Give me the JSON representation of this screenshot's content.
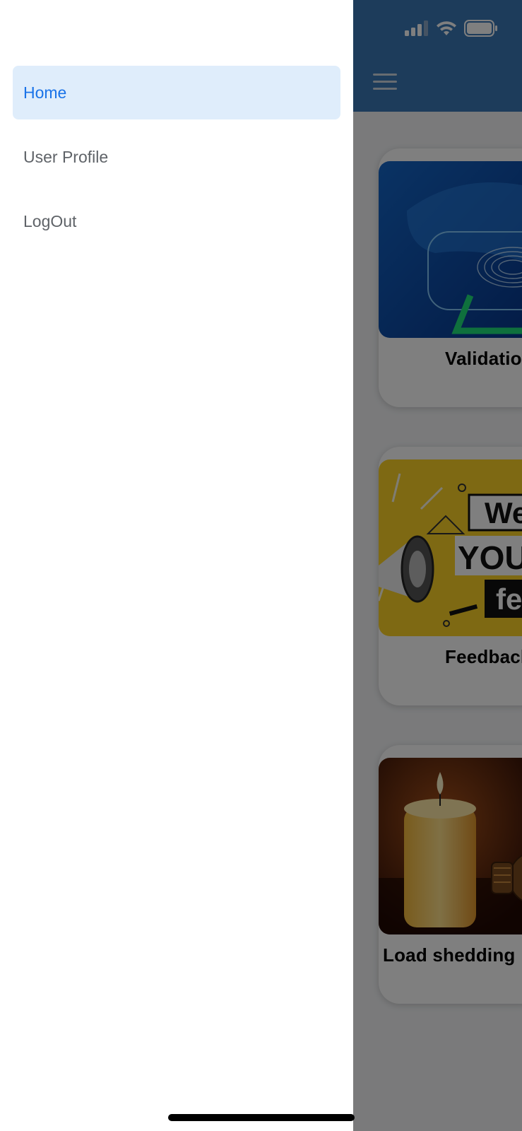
{
  "drawer": {
    "items": [
      {
        "label": "Home",
        "active": true
      },
      {
        "label": "User Profile",
        "active": false
      },
      {
        "label": "LogOut",
        "active": false
      }
    ]
  },
  "app": {
    "header_color": "#3a79b7",
    "menu_icon": "hamburger-menu-icon",
    "cards": [
      {
        "title": "Validation",
        "image": "fingerprint-scan-image"
      },
      {
        "title": "Feedback",
        "image": "megaphone-your-feedback-image"
      },
      {
        "title": "Load shedding",
        "image": "candle-and-bulb-image"
      }
    ]
  },
  "status_bar": {
    "icons": [
      "cellular-signal-icon",
      "wifi-icon",
      "battery-icon"
    ]
  },
  "colors": {
    "drawer_active_bg": "#dfedfb",
    "drawer_active_text": "#1a73e8",
    "drawer_text": "#5f6368",
    "overlay": "rgba(0,0,0,0.5)"
  }
}
